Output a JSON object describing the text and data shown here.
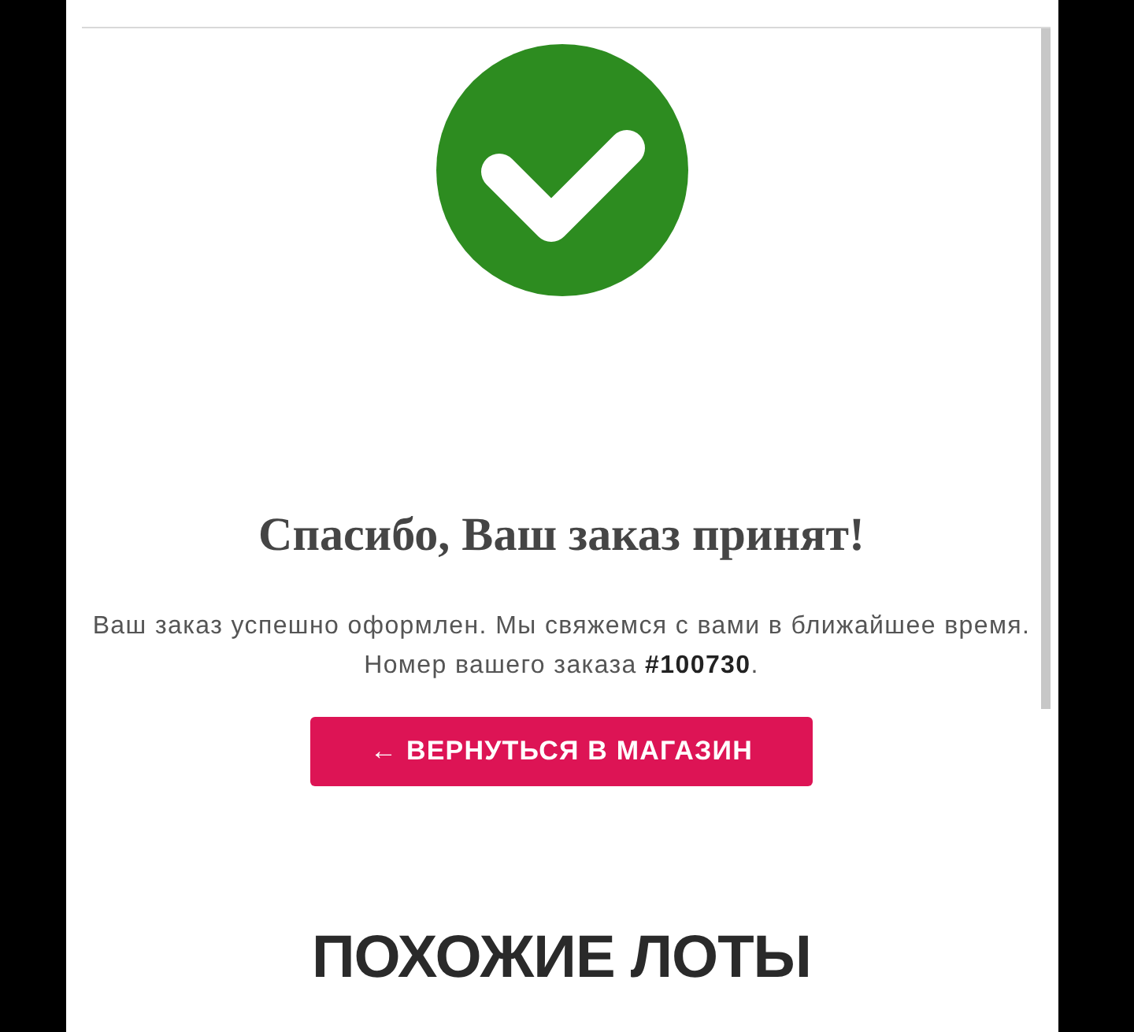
{
  "confirmation": {
    "title": "Спасибо, Ваш заказ принят!",
    "message": "Ваш заказ успешно оформлен. Мы свяжемся с вами в ближайшее время.",
    "order_line": "Номер вашего заказа **#100730**.",
    "button": {
      "label": "← ВЕРНУТЬСЯ В МАГАЗИН"
    }
  },
  "similar_lots": {
    "title": "ПОХОЖИЕ ЛОТЫ"
  }
}
